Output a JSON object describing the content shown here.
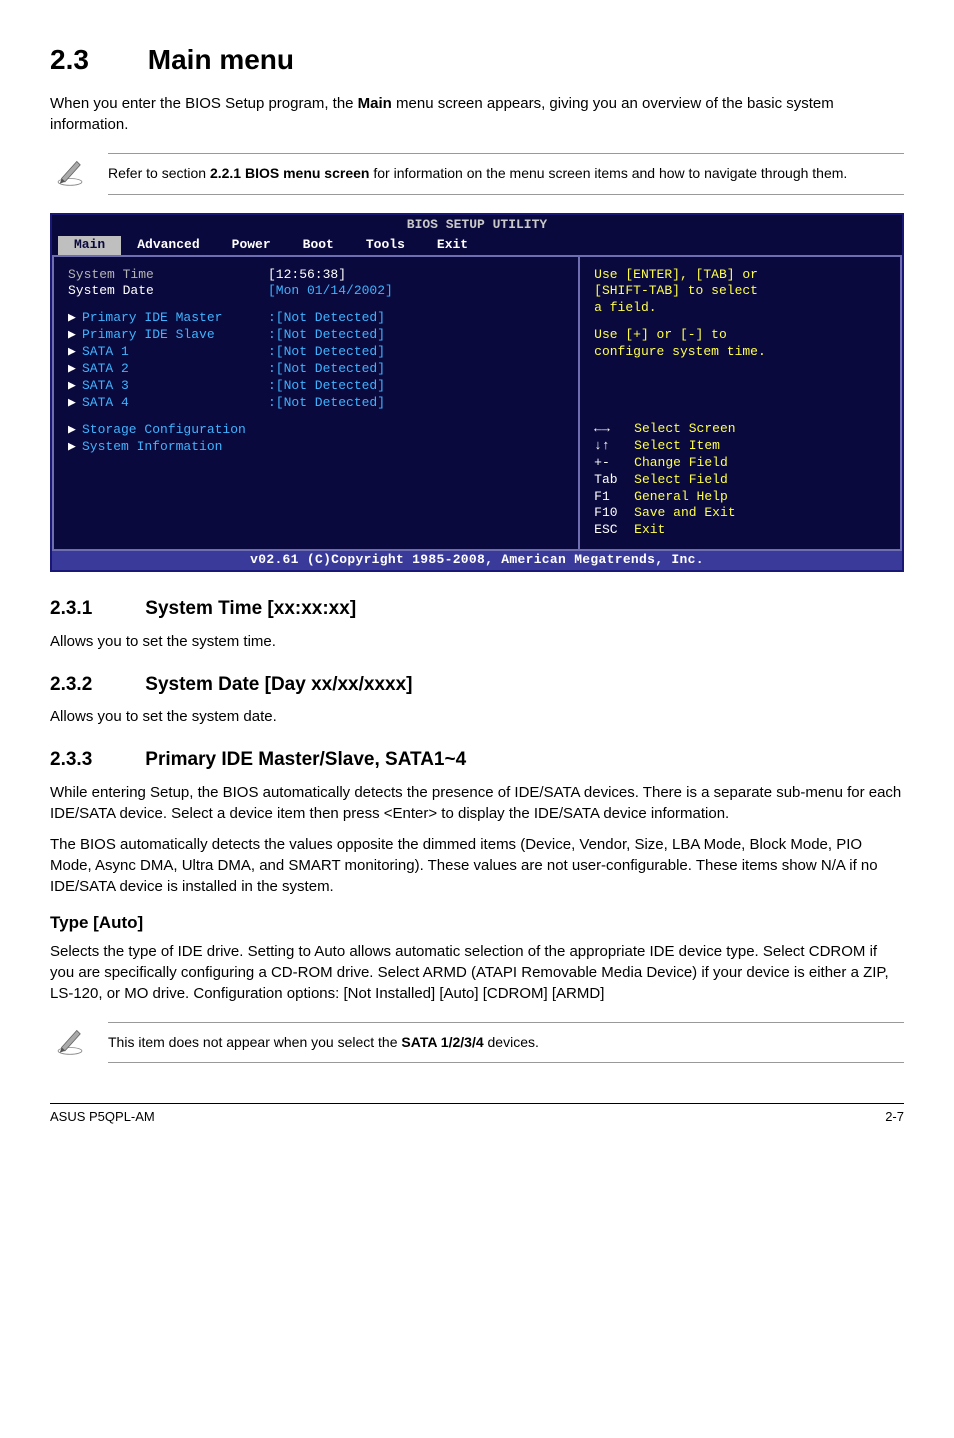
{
  "section": {
    "num": "2.3",
    "title": "Main menu"
  },
  "intro1a": "When you enter the BIOS Setup program, the ",
  "intro1b": "Main",
  "intro1c": " menu screen appears, giving you an overview of the basic system information.",
  "note1a": "Refer to section ",
  "note1b": "2.2.1 BIOS menu screen",
  "note1c": " for information on the menu screen items and how to navigate through them.",
  "bios": {
    "title": "BIOS SETUP UTILITY",
    "tabs": [
      "Main",
      "Advanced",
      "Power",
      "Boot",
      "Tools",
      "Exit"
    ],
    "left": {
      "sys_time_label": "System Time",
      "sys_time_value": "[12:56:38]",
      "sys_date_label": "System Date",
      "sys_date_value": "[Mon 01/14/2002]",
      "rows": [
        {
          "label": "Primary IDE Master",
          "value": ":[Not Detected]"
        },
        {
          "label": "Primary IDE Slave",
          "value": ":[Not Detected]"
        },
        {
          "label": "SATA 1",
          "value": ":[Not Detected]"
        },
        {
          "label": "SATA 2",
          "value": ":[Not Detected]"
        },
        {
          "label": "SATA 3",
          "value": ":[Not Detected]"
        },
        {
          "label": "SATA 4",
          "value": ":[Not Detected]"
        }
      ],
      "storage": "Storage Configuration",
      "sysinfo": "System Information"
    },
    "right": {
      "help1": "Use [ENTER], [TAB] or",
      "help2": "[SHIFT-TAB] to select",
      "help3": "a field.",
      "help4": "Use [+] or [-] to",
      "help5": "configure system time.",
      "nav": [
        {
          "key": "←→",
          "desc": "Select Screen"
        },
        {
          "key": "↓↑",
          "desc": "Select Item"
        },
        {
          "key": "+-",
          "desc": "Change Field"
        },
        {
          "key": "Tab",
          "desc": "Select Field"
        },
        {
          "key": "F1",
          "desc": "General Help"
        },
        {
          "key": "F10",
          "desc": "Save and Exit"
        },
        {
          "key": "ESC",
          "desc": "Exit"
        }
      ]
    },
    "footer": "v02.61 (C)Copyright 1985-2008, American Megatrends, Inc."
  },
  "s231": {
    "num": "2.3.1",
    "title": "System Time [xx:xx:xx]",
    "body": "Allows you to set the system time."
  },
  "s232": {
    "num": "2.3.2",
    "title": "System Date [Day xx/xx/xxxx]",
    "body": "Allows you to set the system date."
  },
  "s233": {
    "num": "2.3.3",
    "title": "Primary IDE Master/Slave, SATA1~4",
    "p1": "While entering Setup, the BIOS automatically detects the presence of IDE/SATA devices. There is a separate sub-menu for each IDE/SATA device. Select a device item then press <Enter> to display the IDE/SATA device information.",
    "p2": "The BIOS automatically detects the values opposite the dimmed items (Device, Vendor, Size, LBA Mode, Block Mode, PIO Mode, Async DMA, Ultra DMA, and SMART monitoring). These values are not user-configurable. These items show N/A if no IDE/SATA device is installed in the system."
  },
  "type": {
    "title": "Type [Auto]",
    "body": "Selects the type of IDE drive. Setting to Auto allows automatic selection of the appropriate IDE device type. Select CDROM if you are specifically configuring a CD-ROM drive. Select ARMD (ATAPI Removable Media Device) if your device is either a ZIP, LS-120, or MO drive. Configuration options: [Not Installed] [Auto] [CDROM] [ARMD]"
  },
  "note2a": "This item does not appear when you select the ",
  "note2b": "SATA 1/2/3/4",
  "note2c": " devices.",
  "footer": {
    "left": "ASUS P5QPL-AM",
    "right": "2-7"
  }
}
